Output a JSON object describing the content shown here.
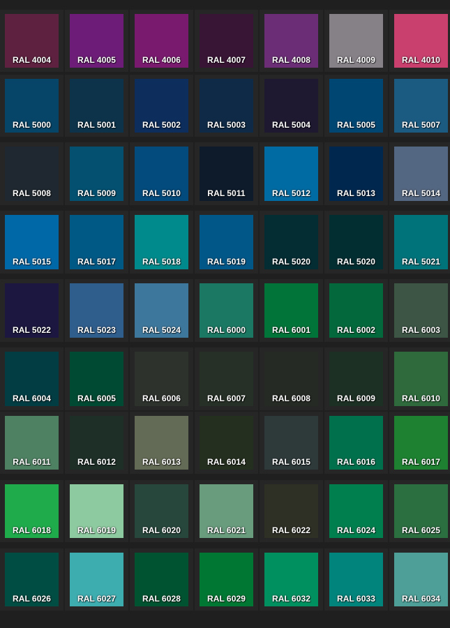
{
  "prefix": "RAL",
  "swatches": [
    {
      "code": "4004",
      "color": "#5e213f"
    },
    {
      "code": "4005",
      "color": "#6d1d77"
    },
    {
      "code": "4006",
      "color": "#7a1a6f"
    },
    {
      "code": "4007",
      "color": "#391535"
    },
    {
      "code": "4008",
      "color": "#6b2e76"
    },
    {
      "code": "4009",
      "color": "#868087"
    },
    {
      "code": "4010",
      "color": "#c93f6e"
    },
    {
      "code": "5000",
      "color": "#064568"
    },
    {
      "code": "5001",
      "color": "#0c334a"
    },
    {
      "code": "5002",
      "color": "#0d2d5d"
    },
    {
      "code": "5003",
      "color": "#0e2a46"
    },
    {
      "code": "5004",
      "color": "#1e1930"
    },
    {
      "code": "5005",
      "color": "#004673"
    },
    {
      "code": "5007",
      "color": "#1b5b82"
    },
    {
      "code": "5008",
      "color": "#1f2830"
    },
    {
      "code": "5009",
      "color": "#035071"
    },
    {
      "code": "5010",
      "color": "#034b7d"
    },
    {
      "code": "5011",
      "color": "#0e1b2b"
    },
    {
      "code": "5012",
      "color": "#006ba2"
    },
    {
      "code": "5013",
      "color": "#00284f"
    },
    {
      "code": "5014",
      "color": "#546782"
    },
    {
      "code": "5015",
      "color": "#0068a7"
    },
    {
      "code": "5017",
      "color": "#005884"
    },
    {
      "code": "5018",
      "color": "#008a8b"
    },
    {
      "code": "5019",
      "color": "#005788"
    },
    {
      "code": "5020",
      "color": "#032c33"
    },
    {
      "code": "5020",
      "color": "#022d31"
    },
    {
      "code": "5021",
      "color": "#00727a"
    },
    {
      "code": "5022",
      "color": "#1b1740"
    },
    {
      "code": "5023",
      "color": "#2f5d8c"
    },
    {
      "code": "5024",
      "color": "#3d779c"
    },
    {
      "code": "6000",
      "color": "#1b7862"
    },
    {
      "code": "6001",
      "color": "#007439"
    },
    {
      "code": "6002",
      "color": "#03683b"
    },
    {
      "code": "6003",
      "color": "#3c5545"
    },
    {
      "code": "6004",
      "color": "#023d43"
    },
    {
      "code": "6005",
      "color": "#004932"
    },
    {
      "code": "6006",
      "color": "#2e322d"
    },
    {
      "code": "6007",
      "color": "#263026"
    },
    {
      "code": "6008",
      "color": "#262a24"
    },
    {
      "code": "6009",
      "color": "#1d3024"
    },
    {
      "code": "6010",
      "color": "#2e6a3c"
    },
    {
      "code": "6011",
      "color": "#4e8162"
    },
    {
      "code": "6012",
      "color": "#1e2f28"
    },
    {
      "code": "6013",
      "color": "#636a55"
    },
    {
      "code": "6014",
      "color": "#252f1f"
    },
    {
      "code": "6015",
      "color": "#2e393a"
    },
    {
      "code": "6016",
      "color": "#00704c"
    },
    {
      "code": "6017",
      "color": "#1d8131"
    },
    {
      "code": "6018",
      "color": "#1fab4c"
    },
    {
      "code": "6019",
      "color": "#8ecaa0"
    },
    {
      "code": "6020",
      "color": "#27473c"
    },
    {
      "code": "6021",
      "color": "#699b7d"
    },
    {
      "code": "6022",
      "color": "#2e2f25"
    },
    {
      "code": "6024",
      "color": "#007f4e"
    },
    {
      "code": "6025",
      "color": "#2b6e40"
    },
    {
      "code": "6026",
      "color": "#004d43"
    },
    {
      "code": "6027",
      "color": "#3eadb0"
    },
    {
      "code": "6028",
      "color": "#005330"
    },
    {
      "code": "6029",
      "color": "#007733"
    },
    {
      "code": "6032",
      "color": "#009060"
    },
    {
      "code": "6033",
      "color": "#00847b"
    },
    {
      "code": "6034",
      "color": "#4e9f98"
    }
  ]
}
